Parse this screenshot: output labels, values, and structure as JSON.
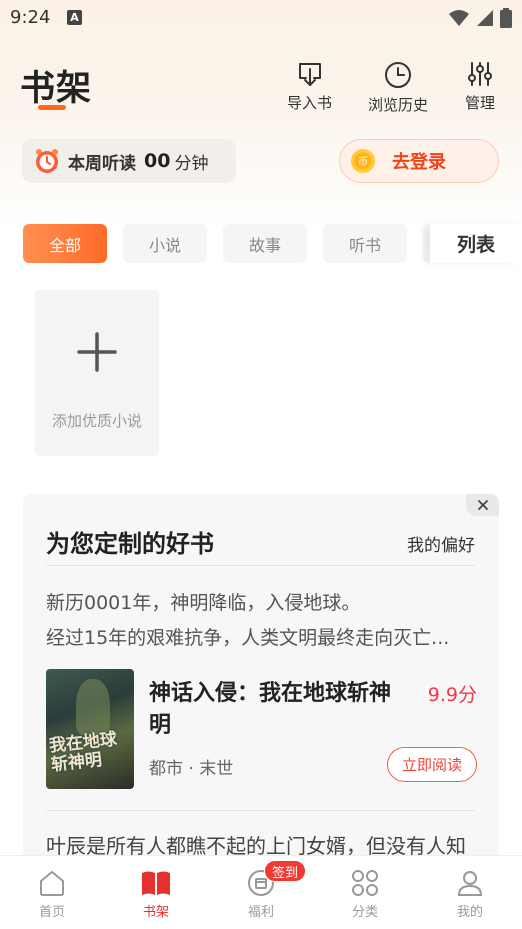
{
  "status_bar": {
    "time": "9:24",
    "notification_letter": "A"
  },
  "header": {
    "title": "书架",
    "actions": [
      {
        "label": "导入书",
        "icon": "import-book-icon"
      },
      {
        "label": "浏览历史",
        "icon": "history-clock-icon"
      },
      {
        "label": "管理",
        "icon": "sliders-icon"
      }
    ]
  },
  "listen": {
    "label": "本周听读",
    "minutes": "00",
    "unit": "分钟"
  },
  "login": {
    "label": "去登录"
  },
  "filters": {
    "chips": [
      "全部",
      "小说",
      "故事",
      "听书"
    ],
    "active": "全部",
    "view_toggle": "列表"
  },
  "add_card": {
    "label": "添加优质小说"
  },
  "recommend": {
    "title": "为您定制的好书",
    "preference": "我的偏好",
    "desc_line1": "新历0001年，神明降临，入侵地球。",
    "desc_line2": "经过15年的艰难抗争，人类文明最终走向灭亡...",
    "book": {
      "name": "神话入侵：我在地球斩神明",
      "score": "9.9分",
      "category": "都市 · 末世",
      "read_label": "立即阅读",
      "cover_text": "我在地球斩神明"
    },
    "next_desc": "叶辰是所有人都瞧不起的上门女婿，但没有人知"
  },
  "bottom_nav": {
    "items": [
      {
        "label": "首页",
        "icon": "home-icon"
      },
      {
        "label": "书架",
        "icon": "bookshelf-icon"
      },
      {
        "label": "福利",
        "icon": "gift-icon"
      },
      {
        "label": "分类",
        "icon": "category-grid-icon"
      },
      {
        "label": "我的",
        "icon": "profile-icon"
      }
    ],
    "active": "书架",
    "badge": "签到"
  },
  "colors": {
    "accent": "#ff6a1a",
    "active_red": "#e63030",
    "price_red": "#f2384b"
  }
}
